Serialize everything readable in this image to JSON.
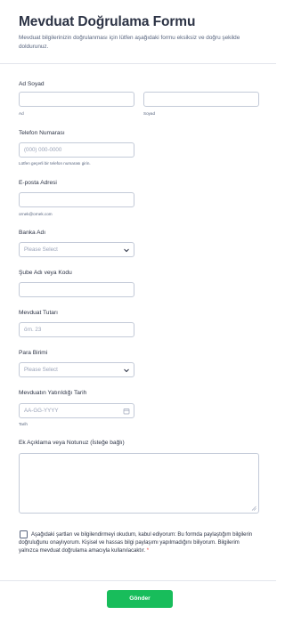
{
  "form": {
    "title": "Mevduat Doğrulama Formu",
    "subtitle": "Mevduat bilgilerinizin doğrulanması için lütfen aşağıdaki formu eksiksiz ve doğru şekilde doldurunuz."
  },
  "fields": {
    "name": {
      "label": "Ad Soyad",
      "first_sublabel": "Ad",
      "last_sublabel": "Soyad",
      "first_value": "",
      "last_value": ""
    },
    "phone": {
      "label": "Telefon Numarası",
      "placeholder": "(000) 000-0000",
      "hint": "Lütfen geçerli bir telefon numarası girin."
    },
    "email": {
      "label": "E-posta Adresi",
      "value": "",
      "hint": "ornek@ornek.com"
    },
    "bank": {
      "label": "Banka Adı",
      "selected": "Please Select"
    },
    "branch": {
      "label": "Şube Adı veya Kodu",
      "value": ""
    },
    "amount": {
      "label": "Mevduat Tutarı",
      "placeholder": "örn. 23"
    },
    "currency": {
      "label": "Para Birimi",
      "selected": "Please Select"
    },
    "date": {
      "label": "Mevduatın Yatırıldığı Tarih",
      "placeholder": "AA-GG-YYYY",
      "sublabel": "Tarih"
    },
    "notes": {
      "label": "Ek Açıklama veya Notunuz (İsteğe bağlı)",
      "value": ""
    }
  },
  "consent": {
    "text": "Aşağıdaki şartları ve bilgilendirmeyi okudum, kabul ediyorum: Bu formda paylaştığım bilgilerin doğruluğunu onaylıyorum. Kişisel ve hassas bilgi paylaşımı yapılmadığını biliyorum. Bilgilerim yalnızca mevduat doğrulama amacıyla kullanılacaktır.",
    "required_mark": "*",
    "checked": false
  },
  "submit_label": "Gönder",
  "icons": {
    "select": "chevron-down-icon",
    "date": "calendar-icon",
    "resize": "resize-grip-icon"
  },
  "colors": {
    "accent": "#18bd5b",
    "required": "#f23a3c",
    "border": "#c3cad8",
    "text": "#2c3345",
    "muted": "#57647e"
  }
}
